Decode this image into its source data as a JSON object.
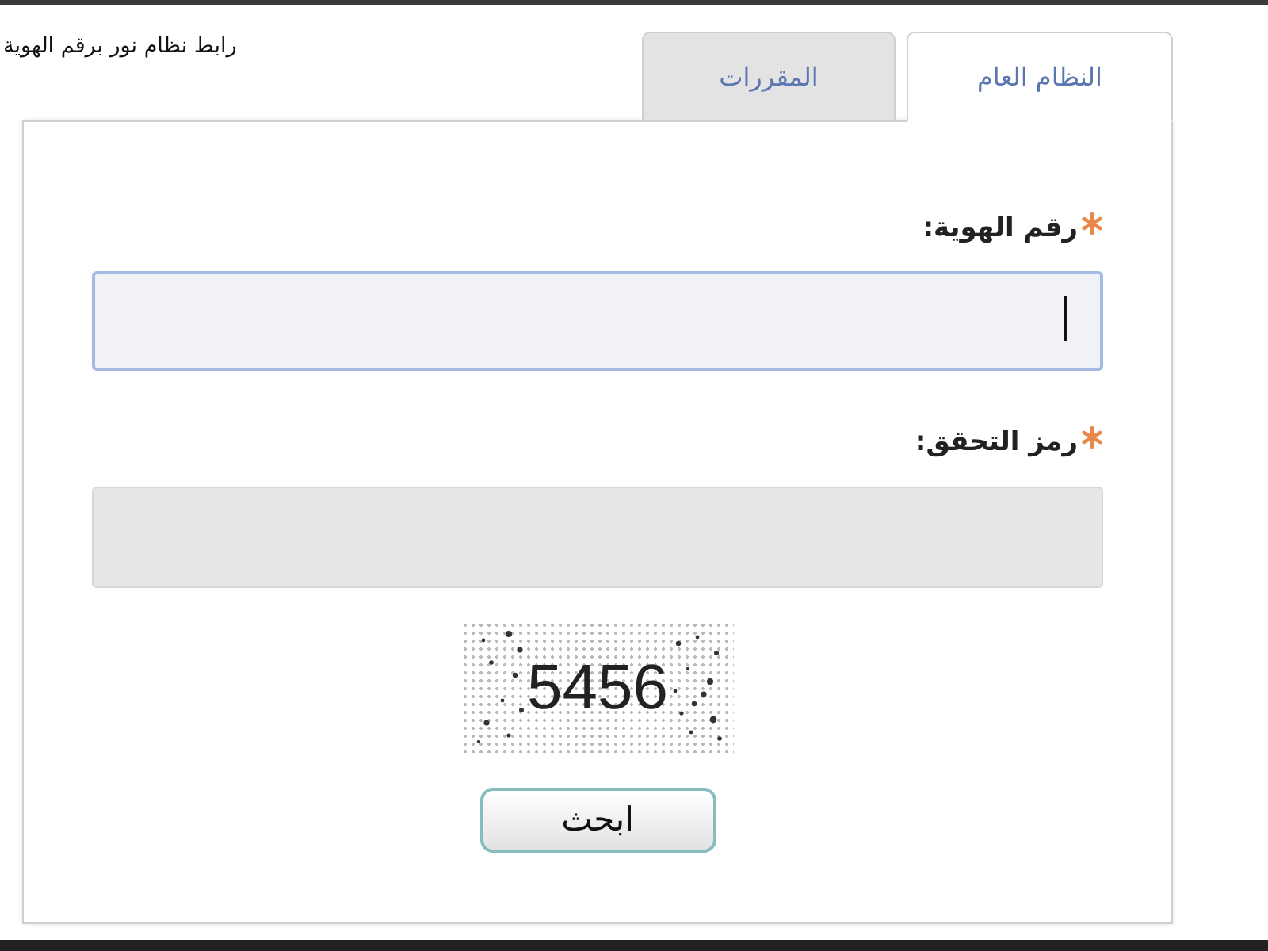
{
  "caption": "رابط نظام نور برقم الهوية",
  "tabs": [
    {
      "label": "النظام العام",
      "selected": true
    },
    {
      "label": "المقررات",
      "selected": false
    }
  ],
  "fields": [
    {
      "label": "رقم الهوية:",
      "required": true,
      "focused": true
    },
    {
      "label": "رمز التحقق:",
      "required": true,
      "focused": false
    }
  ],
  "captcha": {
    "text": "5456"
  },
  "buttons": [
    "ابحث"
  ]
}
